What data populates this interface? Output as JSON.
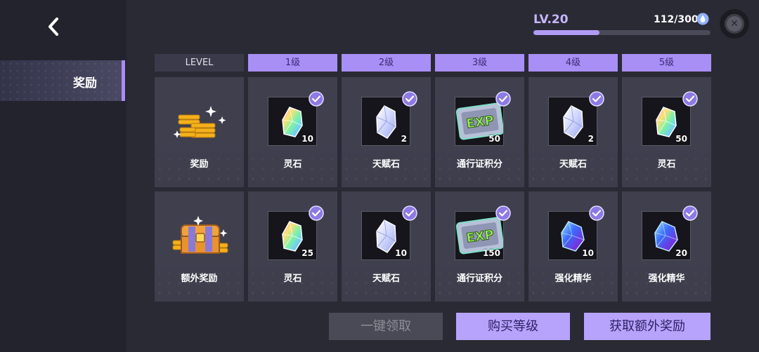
{
  "nav": {
    "back_icon": "chevron-left-icon",
    "items": [
      {
        "label": "奖励"
      }
    ]
  },
  "progress": {
    "level": "LV.20",
    "xp": "112/300",
    "fraction": 0.373,
    "xp_icon": "water-drop-icon"
  },
  "close_icon": "close-icon",
  "table": {
    "level_header": "LEVEL",
    "columns": [
      "1级",
      "2级",
      "3级",
      "4级",
      "5级"
    ],
    "rows": [
      {
        "label": "奖励",
        "icon": "gold-coins-icon",
        "items": [
          {
            "name": "灵石",
            "qty": "10",
            "icon": "rainbow-crystal-icon"
          },
          {
            "name": "天赋石",
            "qty": "2",
            "icon": "white-crystal-icon"
          },
          {
            "name": "通行证积分",
            "qty": "50",
            "icon": "exp-ticket-icon"
          },
          {
            "name": "天赋石",
            "qty": "2",
            "icon": "white-crystal-icon"
          },
          {
            "name": "灵石",
            "qty": "50",
            "icon": "rainbow-crystal-icon"
          }
        ]
      },
      {
        "label": "额外奖励",
        "icon": "treasure-chest-icon",
        "items": [
          {
            "name": "灵石",
            "qty": "25",
            "icon": "rainbow-crystal-icon"
          },
          {
            "name": "天赋石",
            "qty": "10",
            "icon": "white-crystal-icon"
          },
          {
            "name": "通行证积分",
            "qty": "150",
            "icon": "exp-ticket-icon"
          },
          {
            "name": "强化精华",
            "qty": "10",
            "icon": "blue-gem-icon"
          },
          {
            "name": "强化精华",
            "qty": "20",
            "icon": "blue-gem-icon"
          }
        ]
      }
    ]
  },
  "buttons": {
    "claim_all": "一键领取",
    "buy_level": "购买等级",
    "get_extra": "获取额外奖励"
  },
  "colors": {
    "accent": "#a88ff5",
    "button": "#b7a3fb",
    "background": "#2a2a35"
  }
}
